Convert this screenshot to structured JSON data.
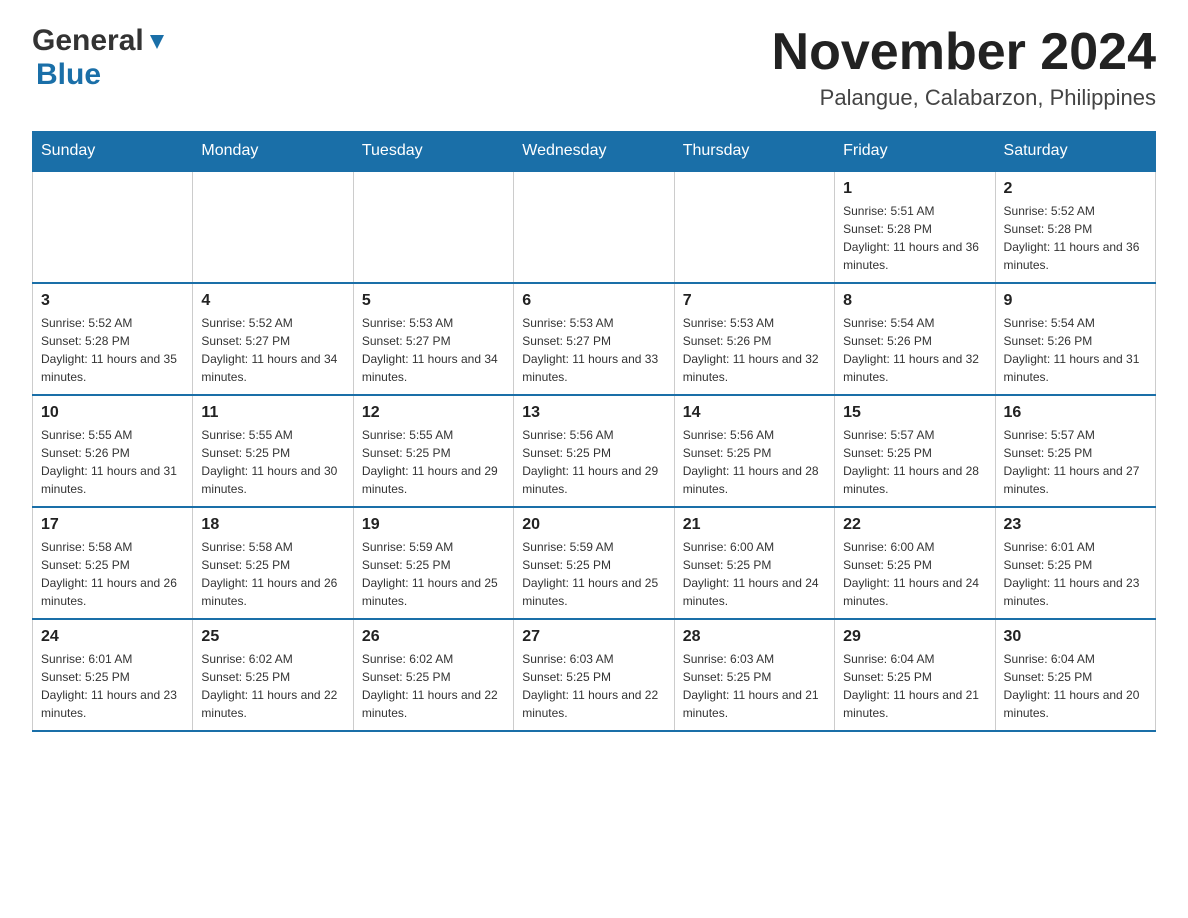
{
  "logo": {
    "general": "General",
    "blue": "Blue"
  },
  "title": "November 2024",
  "subtitle": "Palangue, Calabarzon, Philippines",
  "days_of_week": [
    "Sunday",
    "Monday",
    "Tuesday",
    "Wednesday",
    "Thursday",
    "Friday",
    "Saturday"
  ],
  "weeks": [
    [
      {
        "day": "",
        "info": ""
      },
      {
        "day": "",
        "info": ""
      },
      {
        "day": "",
        "info": ""
      },
      {
        "day": "",
        "info": ""
      },
      {
        "day": "",
        "info": ""
      },
      {
        "day": "1",
        "info": "Sunrise: 5:51 AM\nSunset: 5:28 PM\nDaylight: 11 hours and 36 minutes."
      },
      {
        "day": "2",
        "info": "Sunrise: 5:52 AM\nSunset: 5:28 PM\nDaylight: 11 hours and 36 minutes."
      }
    ],
    [
      {
        "day": "3",
        "info": "Sunrise: 5:52 AM\nSunset: 5:28 PM\nDaylight: 11 hours and 35 minutes."
      },
      {
        "day": "4",
        "info": "Sunrise: 5:52 AM\nSunset: 5:27 PM\nDaylight: 11 hours and 34 minutes."
      },
      {
        "day": "5",
        "info": "Sunrise: 5:53 AM\nSunset: 5:27 PM\nDaylight: 11 hours and 34 minutes."
      },
      {
        "day": "6",
        "info": "Sunrise: 5:53 AM\nSunset: 5:27 PM\nDaylight: 11 hours and 33 minutes."
      },
      {
        "day": "7",
        "info": "Sunrise: 5:53 AM\nSunset: 5:26 PM\nDaylight: 11 hours and 32 minutes."
      },
      {
        "day": "8",
        "info": "Sunrise: 5:54 AM\nSunset: 5:26 PM\nDaylight: 11 hours and 32 minutes."
      },
      {
        "day": "9",
        "info": "Sunrise: 5:54 AM\nSunset: 5:26 PM\nDaylight: 11 hours and 31 minutes."
      }
    ],
    [
      {
        "day": "10",
        "info": "Sunrise: 5:55 AM\nSunset: 5:26 PM\nDaylight: 11 hours and 31 minutes."
      },
      {
        "day": "11",
        "info": "Sunrise: 5:55 AM\nSunset: 5:25 PM\nDaylight: 11 hours and 30 minutes."
      },
      {
        "day": "12",
        "info": "Sunrise: 5:55 AM\nSunset: 5:25 PM\nDaylight: 11 hours and 29 minutes."
      },
      {
        "day": "13",
        "info": "Sunrise: 5:56 AM\nSunset: 5:25 PM\nDaylight: 11 hours and 29 minutes."
      },
      {
        "day": "14",
        "info": "Sunrise: 5:56 AM\nSunset: 5:25 PM\nDaylight: 11 hours and 28 minutes."
      },
      {
        "day": "15",
        "info": "Sunrise: 5:57 AM\nSunset: 5:25 PM\nDaylight: 11 hours and 28 minutes."
      },
      {
        "day": "16",
        "info": "Sunrise: 5:57 AM\nSunset: 5:25 PM\nDaylight: 11 hours and 27 minutes."
      }
    ],
    [
      {
        "day": "17",
        "info": "Sunrise: 5:58 AM\nSunset: 5:25 PM\nDaylight: 11 hours and 26 minutes."
      },
      {
        "day": "18",
        "info": "Sunrise: 5:58 AM\nSunset: 5:25 PM\nDaylight: 11 hours and 26 minutes."
      },
      {
        "day": "19",
        "info": "Sunrise: 5:59 AM\nSunset: 5:25 PM\nDaylight: 11 hours and 25 minutes."
      },
      {
        "day": "20",
        "info": "Sunrise: 5:59 AM\nSunset: 5:25 PM\nDaylight: 11 hours and 25 minutes."
      },
      {
        "day": "21",
        "info": "Sunrise: 6:00 AM\nSunset: 5:25 PM\nDaylight: 11 hours and 24 minutes."
      },
      {
        "day": "22",
        "info": "Sunrise: 6:00 AM\nSunset: 5:25 PM\nDaylight: 11 hours and 24 minutes."
      },
      {
        "day": "23",
        "info": "Sunrise: 6:01 AM\nSunset: 5:25 PM\nDaylight: 11 hours and 23 minutes."
      }
    ],
    [
      {
        "day": "24",
        "info": "Sunrise: 6:01 AM\nSunset: 5:25 PM\nDaylight: 11 hours and 23 minutes."
      },
      {
        "day": "25",
        "info": "Sunrise: 6:02 AM\nSunset: 5:25 PM\nDaylight: 11 hours and 22 minutes."
      },
      {
        "day": "26",
        "info": "Sunrise: 6:02 AM\nSunset: 5:25 PM\nDaylight: 11 hours and 22 minutes."
      },
      {
        "day": "27",
        "info": "Sunrise: 6:03 AM\nSunset: 5:25 PM\nDaylight: 11 hours and 22 minutes."
      },
      {
        "day": "28",
        "info": "Sunrise: 6:03 AM\nSunset: 5:25 PM\nDaylight: 11 hours and 21 minutes."
      },
      {
        "day": "29",
        "info": "Sunrise: 6:04 AM\nSunset: 5:25 PM\nDaylight: 11 hours and 21 minutes."
      },
      {
        "day": "30",
        "info": "Sunrise: 6:04 AM\nSunset: 5:25 PM\nDaylight: 11 hours and 20 minutes."
      }
    ]
  ]
}
